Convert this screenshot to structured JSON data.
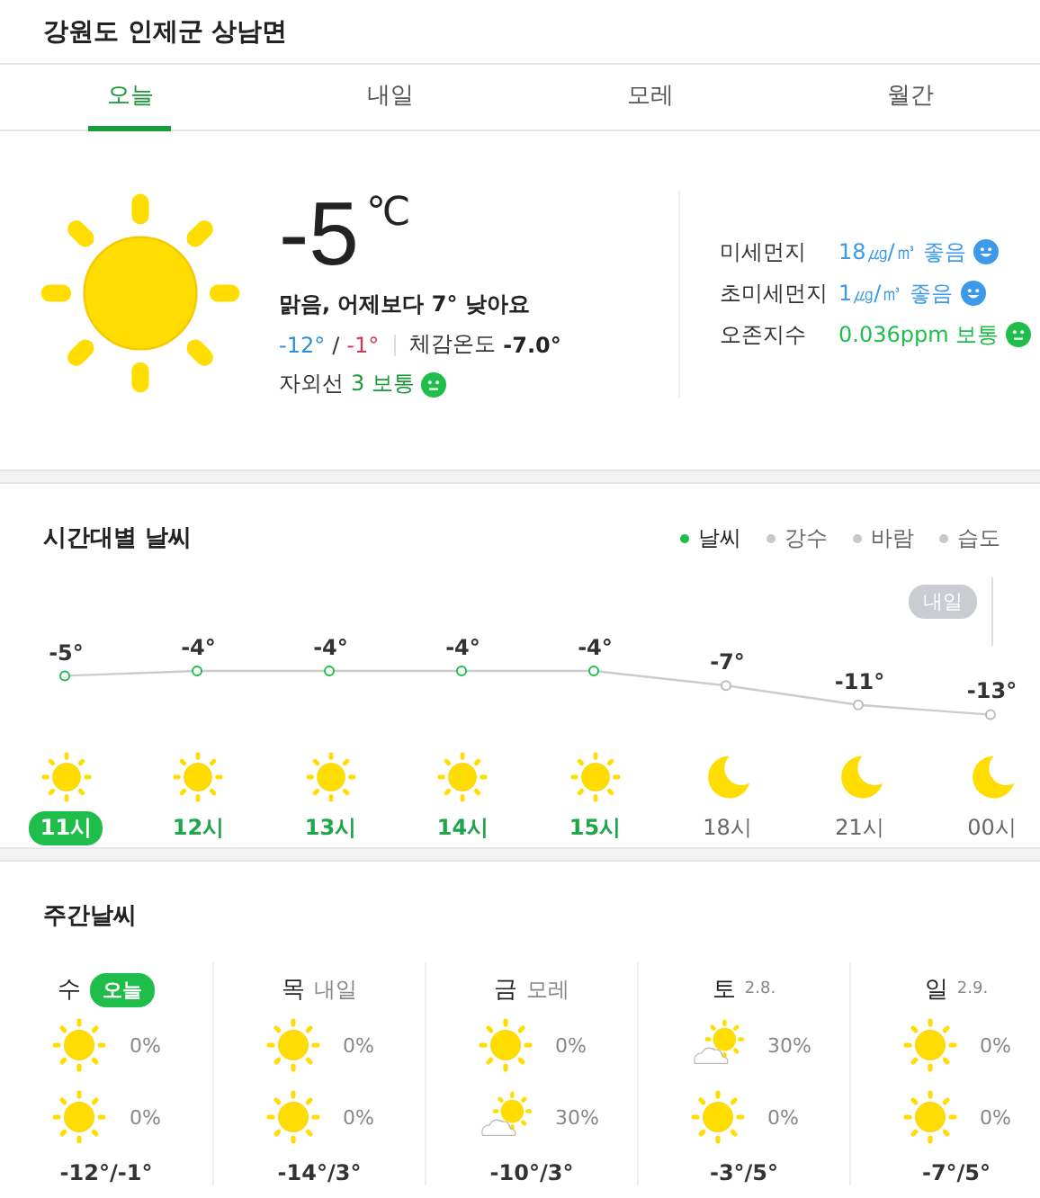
{
  "location": "강원도 인제군 상남면",
  "tabs": [
    {
      "label": "오늘",
      "selected": true
    },
    {
      "label": "내일",
      "selected": false
    },
    {
      "label": "모레",
      "selected": false
    },
    {
      "label": "월간",
      "selected": false
    }
  ],
  "current": {
    "temp": "-5",
    "unit": "℃",
    "summary": "맑음, 어제보다 7° 낮아요",
    "low": "-12°",
    "range_sep": "/",
    "high": "-1°",
    "feels_label": "체감온도",
    "feels_value": "-7.0°",
    "uv_label": "자외선",
    "uv_value": "3 보통",
    "uv_face": {
      "kind": "neutral",
      "color": "#1fbd4a"
    }
  },
  "air": [
    {
      "label": "미세먼지",
      "value": "18㎍/㎥ 좋음",
      "kind": "smile",
      "color": "#3d9ae8"
    },
    {
      "label": "초미세먼지",
      "value": "1㎍/㎥ 좋음",
      "kind": "smile",
      "color": "#3d9ae8"
    },
    {
      "label": "오존지수",
      "value": "0.036ppm 보통",
      "kind": "neutral",
      "color": "#1fbd4a"
    }
  ],
  "hourly": {
    "title": "시간대별 날씨",
    "legend": [
      {
        "label": "날씨",
        "selected": true
      },
      {
        "label": "강수",
        "selected": false
      },
      {
        "label": "바람",
        "selected": false
      },
      {
        "label": "습도",
        "selected": false
      }
    ],
    "day_badge": "내일",
    "items": [
      {
        "temp": "-5°",
        "hour": "11시",
        "kind": "sun",
        "selected": true,
        "daytime": true
      },
      {
        "temp": "-4°",
        "hour": "12시",
        "kind": "sun",
        "selected": false,
        "daytime": true
      },
      {
        "temp": "-4°",
        "hour": "13시",
        "kind": "sun",
        "selected": false,
        "daytime": true
      },
      {
        "temp": "-4°",
        "hour": "14시",
        "kind": "sun",
        "selected": false,
        "daytime": true
      },
      {
        "temp": "-4°",
        "hour": "15시",
        "kind": "sun",
        "selected": false,
        "daytime": true
      },
      {
        "temp": "-7°",
        "hour": "18시",
        "kind": "moon",
        "selected": false,
        "daytime": false
      },
      {
        "temp": "-11°",
        "hour": "21시",
        "kind": "moon",
        "selected": false,
        "daytime": false
      },
      {
        "temp": "-13°",
        "hour": "00시",
        "kind": "moon",
        "selected": false,
        "daytime": false
      }
    ]
  },
  "weekly": {
    "title": "주간날씨",
    "days": [
      {
        "day": "수",
        "sub": "오늘",
        "today": true,
        "am": {
          "kind": "sun",
          "rain": "0%"
        },
        "pm": {
          "kind": "sun",
          "rain": "0%"
        },
        "range": "-12°/-1°"
      },
      {
        "day": "목",
        "sub": "내일",
        "today": false,
        "am": {
          "kind": "sun",
          "rain": "0%"
        },
        "pm": {
          "kind": "sun",
          "rain": "0%"
        },
        "range": "-14°/3°"
      },
      {
        "day": "금",
        "sub": "모레",
        "today": false,
        "am": {
          "kind": "sun",
          "rain": "0%"
        },
        "pm": {
          "kind": "sun-cloud",
          "rain": "30%"
        },
        "range": "-10°/3°"
      },
      {
        "day": "토",
        "sub": "2.8.",
        "today": false,
        "am": {
          "kind": "sun-cloud",
          "rain": "30%"
        },
        "pm": {
          "kind": "sun",
          "rain": "0%"
        },
        "range": "-3°/5°"
      },
      {
        "day": "일",
        "sub": "2.9.",
        "today": false,
        "am": {
          "kind": "sun",
          "rain": "0%"
        },
        "pm": {
          "kind": "sun",
          "rain": "0%"
        },
        "range": "-7°/5°"
      }
    ]
  }
}
